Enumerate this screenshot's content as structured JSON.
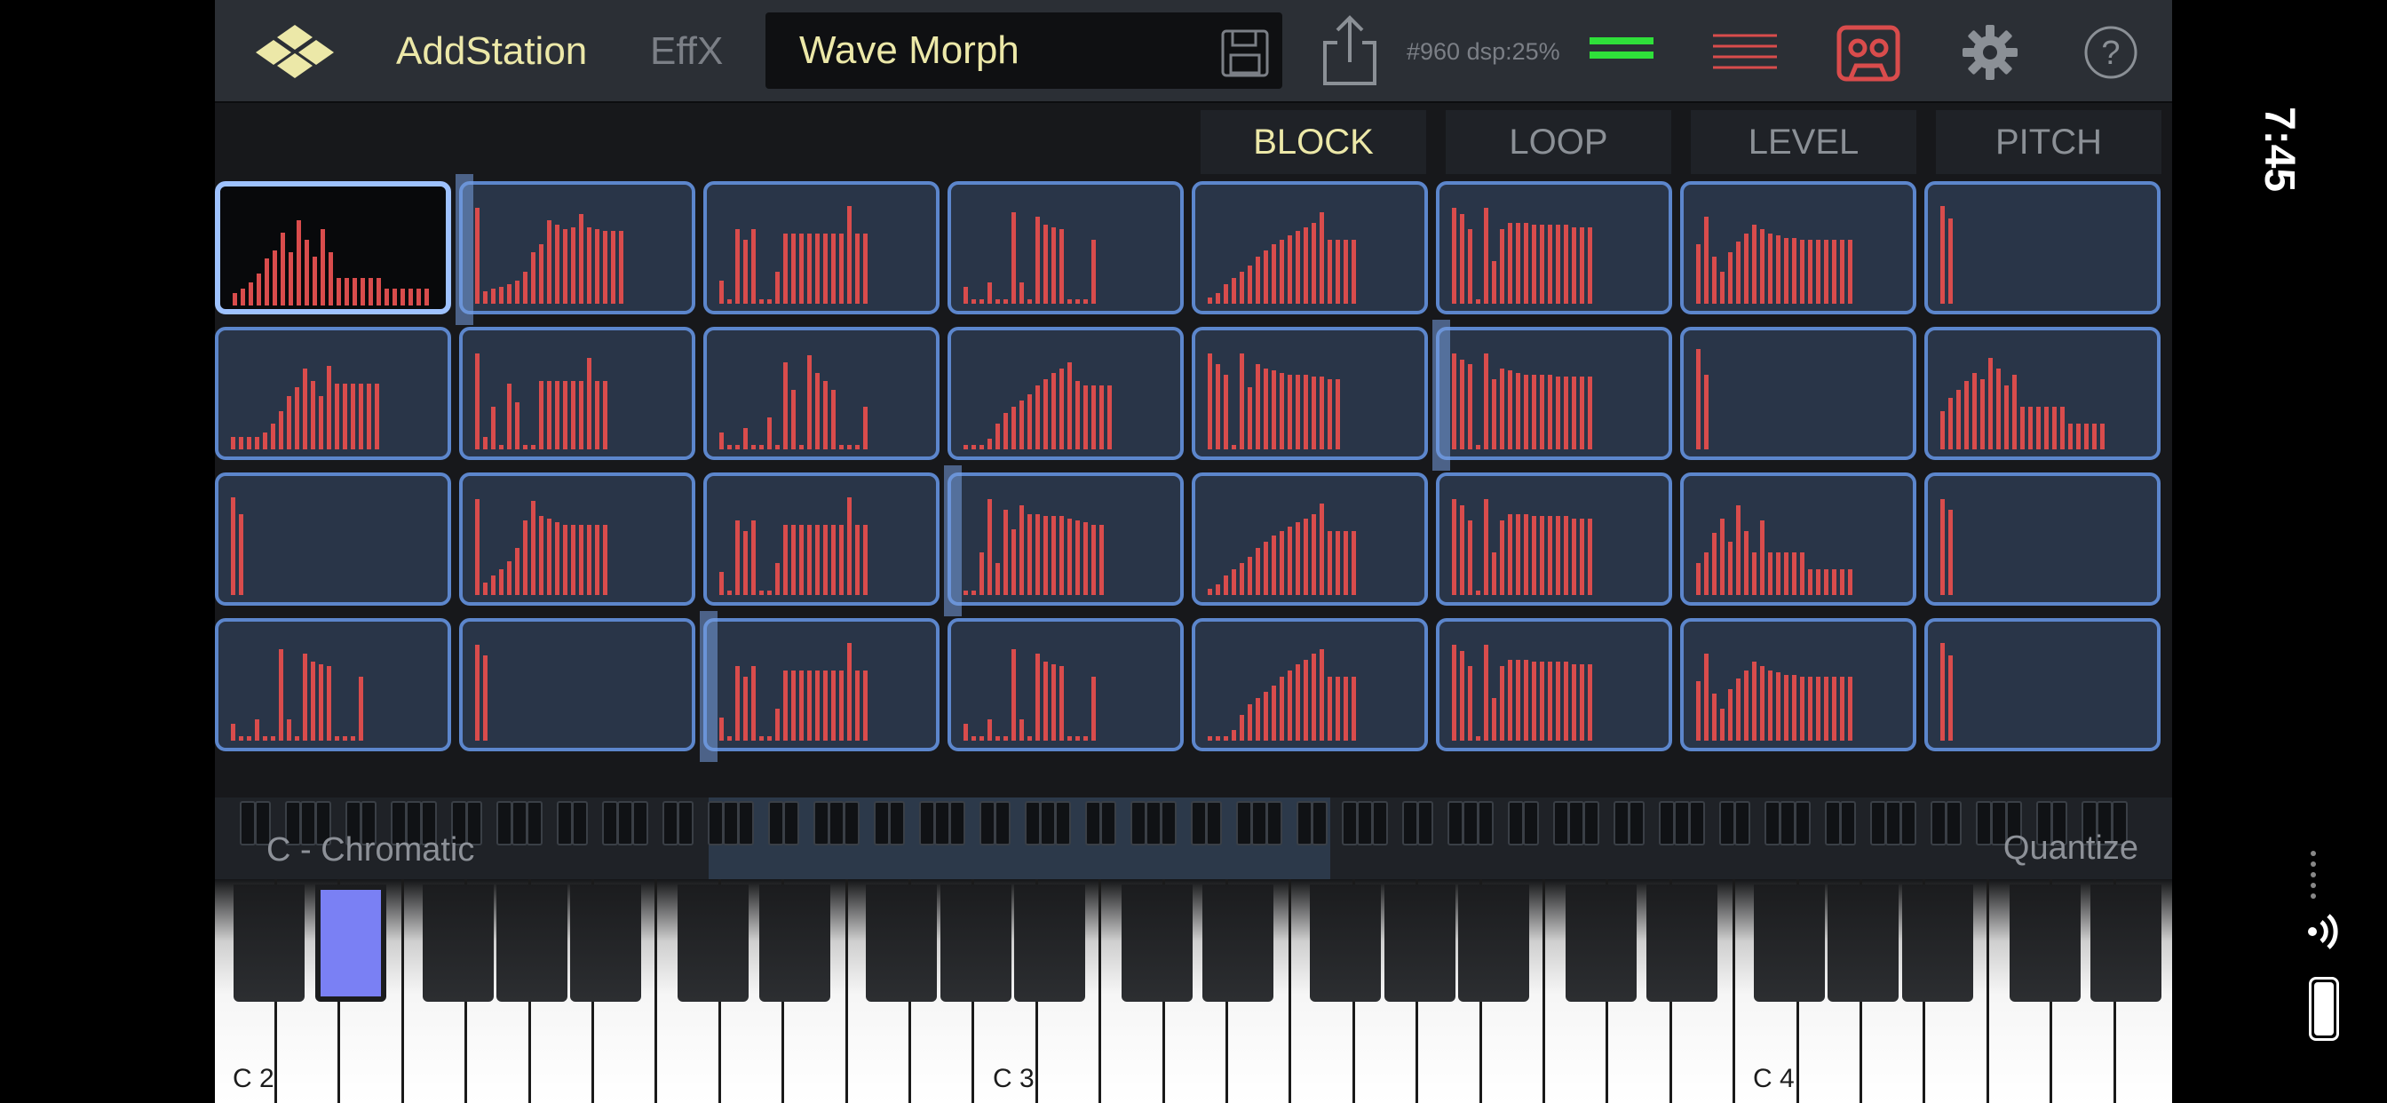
{
  "header": {
    "app_title": "AddStation",
    "effx_tab": "EffX",
    "preset_name": "Wave Morph",
    "stats_text": "#960  dsp:25%"
  },
  "mode_tabs": [
    {
      "label": "BLOCK",
      "active": true
    },
    {
      "label": "LOOP",
      "active": false
    },
    {
      "label": "LEVEL",
      "active": false
    },
    {
      "label": "PITCH",
      "active": false
    }
  ],
  "colors": {
    "accent_text": "#ece8a8",
    "bar_red": "#d94c4c",
    "cell_border": "#5c86cc",
    "meter_green": "#2fe03a",
    "pressed_key": "#7a80f4"
  },
  "harmonic_grid": {
    "rows": 4,
    "cols": 8,
    "selected_cell": 0,
    "cells": [
      [
        12,
        16,
        22,
        30,
        44,
        52,
        68,
        50,
        80,
        62,
        46,
        72,
        50,
        26,
        26,
        26,
        26,
        26,
        26,
        16,
        16,
        16,
        16,
        16,
        16
      ],
      [
        90,
        12,
        14,
        16,
        18,
        22,
        30,
        48,
        56,
        78,
        74,
        70,
        72,
        84,
        72,
        70,
        68,
        68,
        68
      ],
      [
        22,
        4,
        70,
        60,
        70,
        4,
        4,
        30,
        66,
        66,
        66,
        66,
        66,
        66,
        66,
        66,
        92,
        66,
        66
      ],
      [
        16,
        4,
        4,
        20,
        4,
        4,
        86,
        20,
        4,
        82,
        74,
        72,
        70,
        4,
        4,
        4,
        60
      ],
      [
        6,
        10,
        18,
        24,
        30,
        36,
        44,
        50,
        56,
        60,
        64,
        68,
        72,
        76,
        86,
        60,
        60,
        60,
        60
      ],
      [
        90,
        84,
        70,
        4,
        90,
        40,
        70,
        76,
        76,
        76,
        74,
        74,
        74,
        74,
        74,
        72,
        72,
        72
      ],
      [
        56,
        82,
        44,
        30,
        48,
        58,
        66,
        74,
        70,
        66,
        64,
        62,
        62,
        60,
        60,
        60,
        60,
        60,
        60,
        60
      ],
      [
        92,
        80
      ],
      [
        12,
        12,
        12,
        12,
        16,
        24,
        36,
        50,
        58,
        76,
        64,
        50,
        78,
        62,
        62,
        62,
        62,
        62,
        62
      ],
      [
        90,
        12,
        40,
        4,
        62,
        44,
        4,
        4,
        64,
        64,
        64,
        64,
        64,
        64,
        86,
        64,
        64
      ],
      [
        16,
        4,
        4,
        20,
        4,
        4,
        30,
        4,
        82,
        56,
        4,
        88,
        72,
        64,
        56,
        4,
        4,
        4,
        40
      ],
      [
        4,
        4,
        4,
        10,
        24,
        34,
        40,
        46,
        52,
        60,
        66,
        72,
        76,
        82,
        64,
        60,
        60,
        60,
        60
      ],
      [
        90,
        80,
        70,
        4,
        90,
        58,
        80,
        76,
        74,
        72,
        70,
        70,
        70,
        68,
        68,
        66,
        66
      ],
      [
        90,
        84,
        80,
        4,
        90,
        66,
        76,
        74,
        72,
        70,
        70,
        70,
        70,
        68,
        68,
        68,
        68,
        68
      ],
      [
        94,
        70
      ],
      [
        36,
        48,
        56,
        64,
        72,
        66,
        86,
        76,
        60,
        70,
        40,
        40,
        40,
        40,
        40,
        40,
        24,
        24,
        24,
        24,
        24
      ],
      [
        92,
        76
      ],
      [
        90,
        12,
        18,
        24,
        32,
        44,
        70,
        88,
        74,
        72,
        68,
        66,
        66,
        66,
        66,
        66,
        66
      ],
      [
        22,
        4,
        70,
        60,
        70,
        4,
        4,
        30,
        66,
        66,
        66,
        66,
        66,
        66,
        66,
        66,
        92,
        66,
        66
      ],
      [
        4,
        4,
        40,
        90,
        30,
        80,
        62,
        84,
        76,
        76,
        74,
        74,
        74,
        72,
        70,
        68,
        66,
        66
      ],
      [
        6,
        10,
        18,
        24,
        30,
        36,
        44,
        50,
        56,
        60,
        64,
        68,
        72,
        76,
        86,
        60,
        60,
        60,
        60
      ],
      [
        90,
        84,
        70,
        4,
        90,
        40,
        70,
        76,
        76,
        76,
        74,
        74,
        74,
        74,
        74,
        72,
        72,
        72
      ],
      [
        30,
        40,
        58,
        72,
        50,
        84,
        60,
        40,
        70,
        40,
        40,
        40,
        40,
        40,
        24,
        24,
        24,
        24,
        24,
        24
      ],
      [
        90,
        80
      ],
      [
        16,
        4,
        4,
        20,
        4,
        4,
        86,
        20,
        4,
        82,
        74,
        72,
        70,
        4,
        4,
        4,
        60
      ],
      [
        90,
        80
      ],
      [
        22,
        4,
        70,
        60,
        70,
        4,
        4,
        30,
        66,
        66,
        66,
        66,
        66,
        66,
        66,
        66,
        92,
        66,
        66
      ],
      [
        16,
        4,
        4,
        20,
        4,
        4,
        86,
        20,
        4,
        82,
        74,
        72,
        70,
        4,
        4,
        4,
        60
      ],
      [
        4,
        4,
        4,
        10,
        24,
        34,
        40,
        46,
        52,
        60,
        66,
        72,
        76,
        82,
        86,
        60,
        60,
        60,
        60
      ],
      [
        90,
        84,
        70,
        4,
        90,
        40,
        70,
        76,
        76,
        76,
        74,
        74,
        74,
        74,
        74,
        72,
        72,
        72
      ],
      [
        56,
        82,
        44,
        30,
        48,
        58,
        66,
        74,
        70,
        66,
        64,
        62,
        62,
        60,
        60,
        60,
        60,
        60,
        60,
        60
      ],
      [
        92,
        80
      ]
    ],
    "playheads": [
      {
        "row": 0,
        "col": 1
      },
      {
        "row": 1,
        "col": 5
      },
      {
        "row": 2,
        "col": 3
      },
      {
        "row": 3,
        "col": 2
      }
    ]
  },
  "scale": {
    "name": "C - Chromatic",
    "quantize_label": "Quantize"
  },
  "keyboard": {
    "octave_labels": [
      "C 2",
      "C 3",
      "C 4"
    ],
    "pressed_key": "D#2"
  },
  "status": {
    "time": "7:45"
  }
}
